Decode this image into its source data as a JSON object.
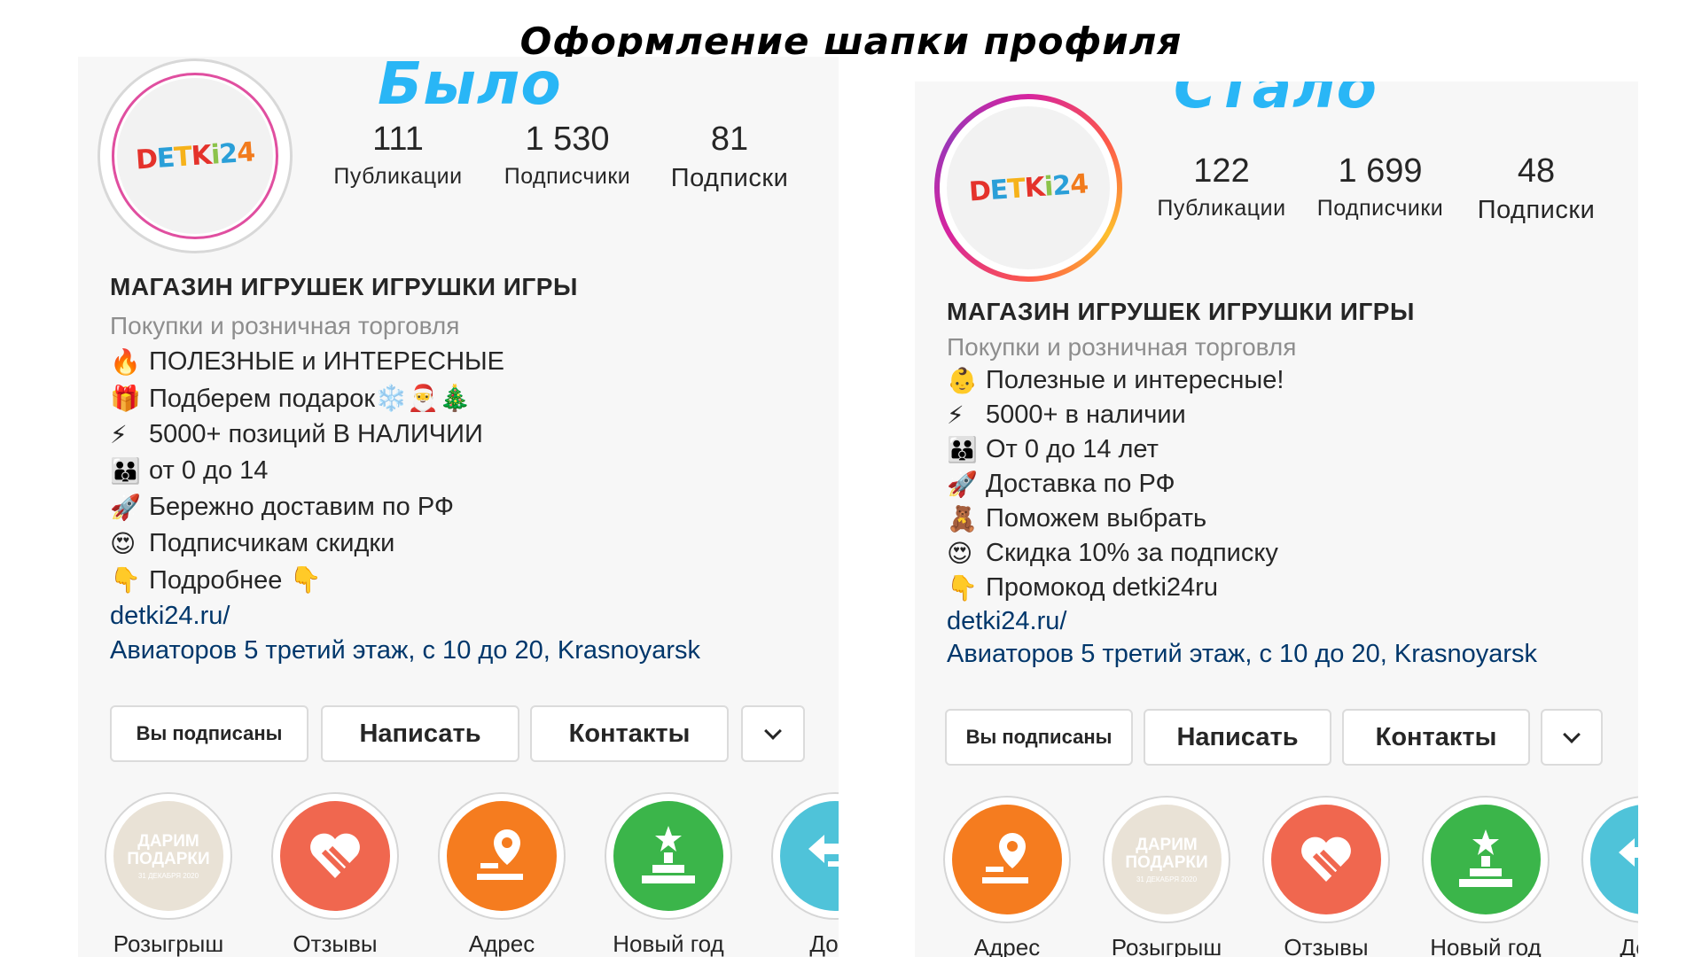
{
  "page_title": "Оформление шапки профиля",
  "before": {
    "state_label": "Было",
    "logo": "DETKi24",
    "stats": [
      {
        "num": "111",
        "label": "Публикации"
      },
      {
        "num": "1 530",
        "label": "Подписчики"
      },
      {
        "num": "81",
        "label": "Подписки"
      }
    ],
    "name": "МАГАЗИН ИГРУШЕК ИГРУШКИ ИГРЫ",
    "category": "Покупки и розничная торговля",
    "bio_lines": [
      {
        "emoji": "🔥",
        "text": "ПОЛЕЗНЫЕ и ИНТЕРЕСНЫЕ"
      },
      {
        "emoji": "🎁",
        "text": "Подберем подарок❄️🎅🎄"
      },
      {
        "emoji": "⚡",
        "text": "5000+ позиций В НАЛИЧИИ"
      },
      {
        "emoji": "👪",
        "text": "от 0 до 14"
      },
      {
        "emoji": "🚀",
        "text": "Бережно доставим по РФ"
      },
      {
        "emoji": "😍",
        "text": "Подписчикам скидки"
      },
      {
        "emoji": "👇",
        "text": "Подробнее 👇"
      }
    ],
    "link": "detki24.ru/",
    "address": "Авиаторов 5 третий этаж, с 10 до 20, Krasnoyarsk",
    "buttons": {
      "following": "Вы подписаны",
      "message": "Написать",
      "contacts": "Контакты"
    },
    "highlights": [
      {
        "label": "Розыгрыш",
        "icon": "gift-card",
        "color": "#e9e2d6",
        "card_title": "ДАРИМ ПОДАРКИ",
        "card_date": "31 ДЕКАБРЯ 2020"
      },
      {
        "label": "Отзывы",
        "icon": "heart-icon",
        "color": "#f0674f"
      },
      {
        "label": "Адрес",
        "icon": "location-pin-icon",
        "color": "#f57c1f"
      },
      {
        "label": "Новый год",
        "icon": "podium-star-icon",
        "color": "#3bb54a"
      },
      {
        "label": "Дост",
        "icon": "delivery-icon",
        "color": "#4fc3d9"
      }
    ]
  },
  "after": {
    "state_label": "Стало",
    "logo": "DETKi24",
    "stats": [
      {
        "num": "122",
        "label": "Публикации"
      },
      {
        "num": "1 699",
        "label": "Подписчики"
      },
      {
        "num": "48",
        "label": "Подписки"
      }
    ],
    "name": "МАГАЗИН ИГРУШЕК ИГРУШКИ ИГРЫ",
    "category": "Покупки и розничная торговля",
    "bio_lines": [
      {
        "emoji": "👶",
        "text": "Полезные и интересные!"
      },
      {
        "emoji": "⚡",
        "text": "5000+ в наличии"
      },
      {
        "emoji": "👪",
        "text": "От 0 до 14 лет"
      },
      {
        "emoji": "🚀",
        "text": "Доставка по РФ"
      },
      {
        "emoji": "🧸",
        "text": "Поможем выбрать"
      },
      {
        "emoji": "😍",
        "text": "Скидка 10% за подписку"
      },
      {
        "emoji": "👇",
        "text": "Промокод detki24ru"
      }
    ],
    "link": "detki24.ru/",
    "address": "Авиаторов 5 третий этаж, с 10 до 20, Krasnoyarsk",
    "buttons": {
      "following": "Вы подписаны",
      "message": "Написать",
      "contacts": "Контакты"
    },
    "highlights": [
      {
        "label": "Адрес",
        "icon": "location-pin-icon",
        "color": "#f57c1f"
      },
      {
        "label": "Розыгрыш",
        "icon": "gift-card",
        "color": "#e9e2d6",
        "card_title": "ДАРИМ ПОДАРКИ",
        "card_date": "31 ДЕКАБРЯ 2020"
      },
      {
        "label": "Отзывы",
        "icon": "heart-icon",
        "color": "#f0674f"
      },
      {
        "label": "Новый год",
        "icon": "podium-star-icon",
        "color": "#3bb54a"
      },
      {
        "label": "Дост",
        "icon": "delivery-icon",
        "color": "#4fc3d9"
      }
    ]
  },
  "colors": {
    "state_label": "#29b6f6",
    "link": "#00376b",
    "category": "#8e8e8e"
  }
}
